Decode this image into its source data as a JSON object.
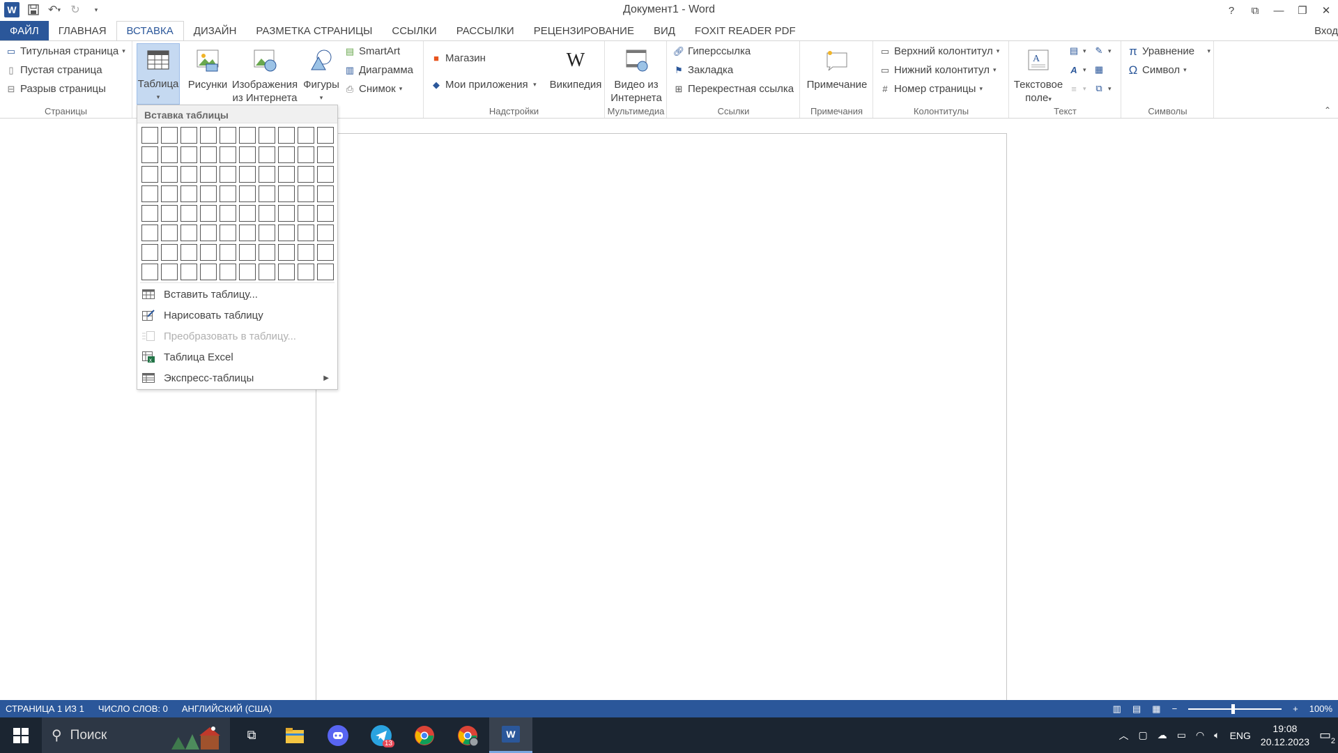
{
  "window": {
    "title": "Документ1 - Word",
    "help": "?",
    "signin": "Вход"
  },
  "tabs": [
    {
      "label": "ФАЙЛ",
      "state": "file"
    },
    {
      "label": "ГЛАВНАЯ"
    },
    {
      "label": "ВСТАВКА",
      "state": "active"
    },
    {
      "label": "ДИЗАЙН"
    },
    {
      "label": "РАЗМЕТКА СТРАНИЦЫ"
    },
    {
      "label": "ССЫЛКИ"
    },
    {
      "label": "РАССЫЛКИ"
    },
    {
      "label": "РЕЦЕНЗИРОВАНИЕ"
    },
    {
      "label": "ВИД"
    },
    {
      "label": "FOXIT READER PDF"
    }
  ],
  "ribbon": {
    "pages": {
      "label": "Страницы",
      "cover": "Титульная страница",
      "blank": "Пустая страница",
      "break": "Разрыв страницы"
    },
    "tables": {
      "table": "Таблица"
    },
    "illustrations": {
      "pictures": "Рисунки",
      "online_pictures_1": "Изображения",
      "online_pictures_2": "из Интернета",
      "shapes": "Фигуры",
      "smartart": "SmartArt",
      "chart": "Диаграмма",
      "screenshot": "Снимок"
    },
    "addins": {
      "label": "Надстройки",
      "store": "Магазин",
      "my_apps": "Мои приложения",
      "wikipedia": "Википедия"
    },
    "media": {
      "label": "Мультимедиа",
      "video_1": "Видео из",
      "video_2": "Интернета"
    },
    "links": {
      "label": "Ссылки",
      "hyperlink": "Гиперссылка",
      "bookmark": "Закладка",
      "cross_ref": "Перекрестная ссылка"
    },
    "comments": {
      "label": "Примечания",
      "comment": "Примечание"
    },
    "header_footer": {
      "label": "Колонтитулы",
      "header": "Верхний колонтитул",
      "footer": "Нижний колонтитул",
      "page_number": "Номер страницы"
    },
    "text": {
      "label": "Текст",
      "textbox_1": "Текстовое",
      "textbox_2": "поле"
    },
    "symbols": {
      "label": "Символы",
      "equation": "Уравнение",
      "symbol": "Символ"
    }
  },
  "table_dropdown": {
    "header": "Вставка таблицы",
    "grid_cols": 10,
    "grid_rows": 8,
    "items": [
      {
        "label": "Вставить таблицу...",
        "disabled": false,
        "icon": "insert-table-icon"
      },
      {
        "label": "Нарисовать таблицу",
        "disabled": false,
        "icon": "draw-table-icon"
      },
      {
        "label": "Преобразовать в таблицу...",
        "disabled": true,
        "icon": "convert-table-icon"
      },
      {
        "label": "Таблица Excel",
        "disabled": false,
        "icon": "excel-table-icon"
      },
      {
        "label": "Экспресс-таблицы",
        "disabled": false,
        "icon": "quick-tables-icon",
        "submenu": true
      }
    ]
  },
  "status": {
    "page": "СТРАНИЦА 1 ИЗ 1",
    "words": "ЧИСЛО СЛОВ: 0",
    "language": "АНГЛИЙСКИЙ (США)",
    "zoom": "100%"
  },
  "taskbar": {
    "search_placeholder": "Поиск",
    "telegram_badge": "13",
    "lang": "ENG",
    "time": "19:08",
    "date": "20.12.2023",
    "notifications": "2"
  },
  "colors": {
    "accent": "#2b579a",
    "taskbar": "#1b2531"
  }
}
